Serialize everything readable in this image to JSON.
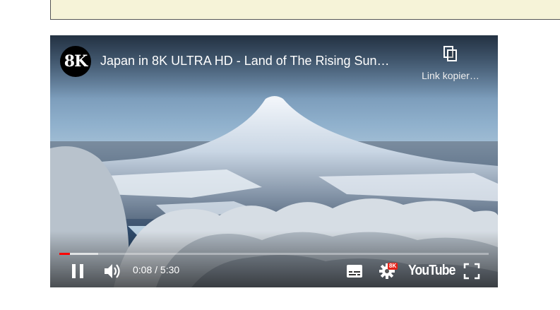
{
  "player": {
    "channel_avatar_text": "8K",
    "title": "Japan in 8K ULTRA HD - Land of The Rising Sun…",
    "copy_link_label": "Link kopier…",
    "time_display": "0:08 / 5:30",
    "played_fraction": 0.025,
    "loaded_fraction": 0.09,
    "settings_badge": "8K",
    "youtube_logo_text": "YouTube",
    "icons": {
      "copy": "copy-icon",
      "pause": "pause-icon",
      "volume": "volume-icon",
      "subtitles": "subtitles-icon",
      "settings": "gear-icon",
      "fullscreen": "fullscreen-icon"
    },
    "colors": {
      "progress": "#ff0000",
      "badge": "#e62117"
    }
  }
}
